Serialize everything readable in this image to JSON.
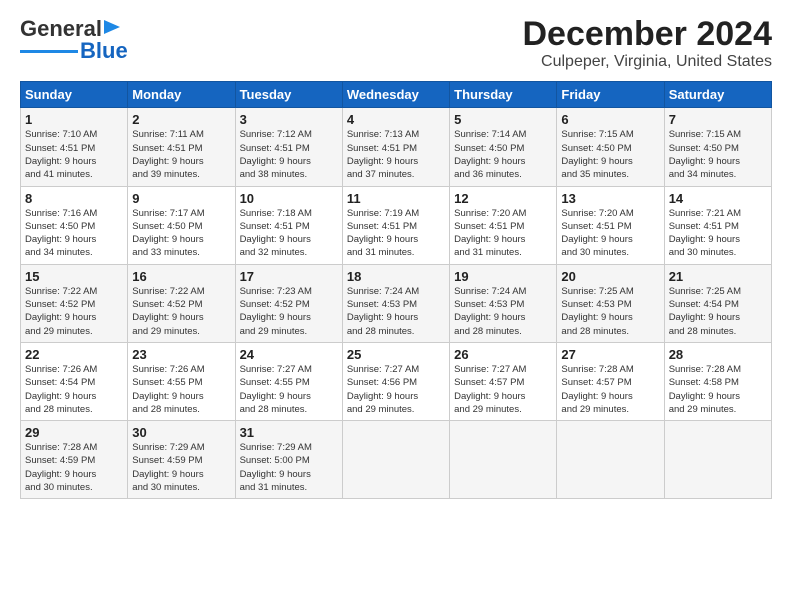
{
  "logo": {
    "line1": "General",
    "line2": "Blue"
  },
  "title": "December 2024",
  "subtitle": "Culpeper, Virginia, United States",
  "days_of_week": [
    "Sunday",
    "Monday",
    "Tuesday",
    "Wednesday",
    "Thursday",
    "Friday",
    "Saturday"
  ],
  "weeks": [
    [
      {
        "day": "1",
        "info": "Sunrise: 7:10 AM\nSunset: 4:51 PM\nDaylight: 9 hours\nand 41 minutes."
      },
      {
        "day": "2",
        "info": "Sunrise: 7:11 AM\nSunset: 4:51 PM\nDaylight: 9 hours\nand 39 minutes."
      },
      {
        "day": "3",
        "info": "Sunrise: 7:12 AM\nSunset: 4:51 PM\nDaylight: 9 hours\nand 38 minutes."
      },
      {
        "day": "4",
        "info": "Sunrise: 7:13 AM\nSunset: 4:51 PM\nDaylight: 9 hours\nand 37 minutes."
      },
      {
        "day": "5",
        "info": "Sunrise: 7:14 AM\nSunset: 4:50 PM\nDaylight: 9 hours\nand 36 minutes."
      },
      {
        "day": "6",
        "info": "Sunrise: 7:15 AM\nSunset: 4:50 PM\nDaylight: 9 hours\nand 35 minutes."
      },
      {
        "day": "7",
        "info": "Sunrise: 7:15 AM\nSunset: 4:50 PM\nDaylight: 9 hours\nand 34 minutes."
      }
    ],
    [
      {
        "day": "8",
        "info": "Sunrise: 7:16 AM\nSunset: 4:50 PM\nDaylight: 9 hours\nand 34 minutes."
      },
      {
        "day": "9",
        "info": "Sunrise: 7:17 AM\nSunset: 4:50 PM\nDaylight: 9 hours\nand 33 minutes."
      },
      {
        "day": "10",
        "info": "Sunrise: 7:18 AM\nSunset: 4:51 PM\nDaylight: 9 hours\nand 32 minutes."
      },
      {
        "day": "11",
        "info": "Sunrise: 7:19 AM\nSunset: 4:51 PM\nDaylight: 9 hours\nand 31 minutes."
      },
      {
        "day": "12",
        "info": "Sunrise: 7:20 AM\nSunset: 4:51 PM\nDaylight: 9 hours\nand 31 minutes."
      },
      {
        "day": "13",
        "info": "Sunrise: 7:20 AM\nSunset: 4:51 PM\nDaylight: 9 hours\nand 30 minutes."
      },
      {
        "day": "14",
        "info": "Sunrise: 7:21 AM\nSunset: 4:51 PM\nDaylight: 9 hours\nand 30 minutes."
      }
    ],
    [
      {
        "day": "15",
        "info": "Sunrise: 7:22 AM\nSunset: 4:52 PM\nDaylight: 9 hours\nand 29 minutes."
      },
      {
        "day": "16",
        "info": "Sunrise: 7:22 AM\nSunset: 4:52 PM\nDaylight: 9 hours\nand 29 minutes."
      },
      {
        "day": "17",
        "info": "Sunrise: 7:23 AM\nSunset: 4:52 PM\nDaylight: 9 hours\nand 29 minutes."
      },
      {
        "day": "18",
        "info": "Sunrise: 7:24 AM\nSunset: 4:53 PM\nDaylight: 9 hours\nand 28 minutes."
      },
      {
        "day": "19",
        "info": "Sunrise: 7:24 AM\nSunset: 4:53 PM\nDaylight: 9 hours\nand 28 minutes."
      },
      {
        "day": "20",
        "info": "Sunrise: 7:25 AM\nSunset: 4:53 PM\nDaylight: 9 hours\nand 28 minutes."
      },
      {
        "day": "21",
        "info": "Sunrise: 7:25 AM\nSunset: 4:54 PM\nDaylight: 9 hours\nand 28 minutes."
      }
    ],
    [
      {
        "day": "22",
        "info": "Sunrise: 7:26 AM\nSunset: 4:54 PM\nDaylight: 9 hours\nand 28 minutes."
      },
      {
        "day": "23",
        "info": "Sunrise: 7:26 AM\nSunset: 4:55 PM\nDaylight: 9 hours\nand 28 minutes."
      },
      {
        "day": "24",
        "info": "Sunrise: 7:27 AM\nSunset: 4:55 PM\nDaylight: 9 hours\nand 28 minutes."
      },
      {
        "day": "25",
        "info": "Sunrise: 7:27 AM\nSunset: 4:56 PM\nDaylight: 9 hours\nand 29 minutes."
      },
      {
        "day": "26",
        "info": "Sunrise: 7:27 AM\nSunset: 4:57 PM\nDaylight: 9 hours\nand 29 minutes."
      },
      {
        "day": "27",
        "info": "Sunrise: 7:28 AM\nSunset: 4:57 PM\nDaylight: 9 hours\nand 29 minutes."
      },
      {
        "day": "28",
        "info": "Sunrise: 7:28 AM\nSunset: 4:58 PM\nDaylight: 9 hours\nand 29 minutes."
      }
    ],
    [
      {
        "day": "29",
        "info": "Sunrise: 7:28 AM\nSunset: 4:59 PM\nDaylight: 9 hours\nand 30 minutes."
      },
      {
        "day": "30",
        "info": "Sunrise: 7:29 AM\nSunset: 4:59 PM\nDaylight: 9 hours\nand 30 minutes."
      },
      {
        "day": "31",
        "info": "Sunrise: 7:29 AM\nSunset: 5:00 PM\nDaylight: 9 hours\nand 31 minutes."
      },
      {
        "day": "",
        "info": ""
      },
      {
        "day": "",
        "info": ""
      },
      {
        "day": "",
        "info": ""
      },
      {
        "day": "",
        "info": ""
      }
    ]
  ]
}
